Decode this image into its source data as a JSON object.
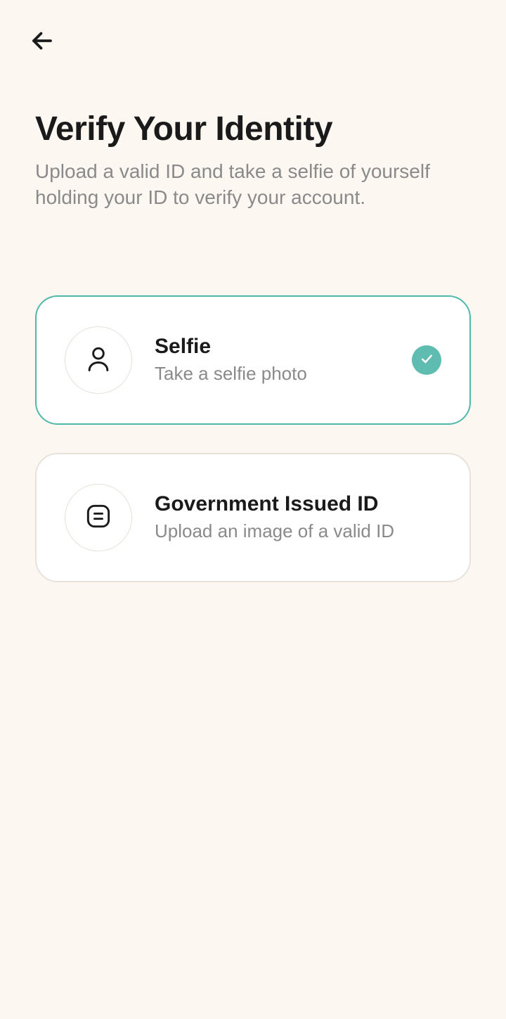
{
  "header": {
    "title": "Verify Your Identity",
    "subtitle": "Upload a valid ID and take a selfie of yourself holding your ID to verify your account."
  },
  "options": [
    {
      "title": "Selfie",
      "subtitle": "Take a selfie photo",
      "selected": true
    },
    {
      "title": "Government Issued ID",
      "subtitle": "Upload an image of a valid ID",
      "selected": false
    }
  ]
}
